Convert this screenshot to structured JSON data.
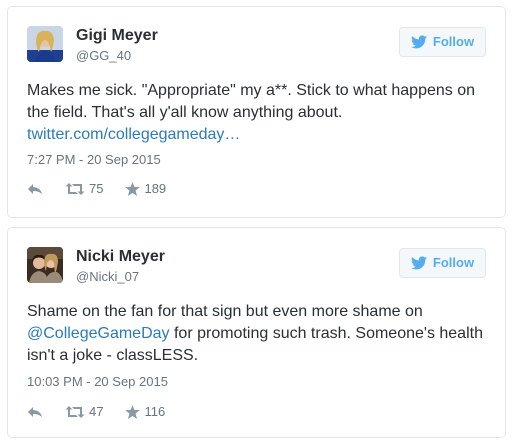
{
  "colors": {
    "link": "#2b7bb9",
    "follow_text": "#55acee",
    "meta": "#66757f",
    "border": "#e1e8ed"
  },
  "tweets": [
    {
      "name": "Gigi Meyer",
      "handle": "@GG_40",
      "follow_label": "Follow",
      "text_main": "Makes me sick. \"Appropriate\" my a**. Stick to what happens on the field. That's all y'all know anything about. ",
      "link": "twitter.com/collegegameday…",
      "timestamp": "7:27 PM - 20 Sep 2015",
      "retweets": "75",
      "likes": "189"
    },
    {
      "name": "Nicki Meyer",
      "handle": "@Nicki_07",
      "follow_label": "Follow",
      "text_before": "Shame on the fan for that sign but even more shame on ",
      "mention": "@CollegeGameDay",
      "text_after": " for promoting such trash. Someone's health isn't a joke - classLESS.",
      "timestamp": "10:03 PM - 20 Sep 2015",
      "retweets": "47",
      "likes": "116"
    }
  ],
  "icons": {
    "reply": "reply-icon",
    "retweet": "retweet-icon",
    "like": "star-icon",
    "follow": "twitter-bird-icon"
  }
}
